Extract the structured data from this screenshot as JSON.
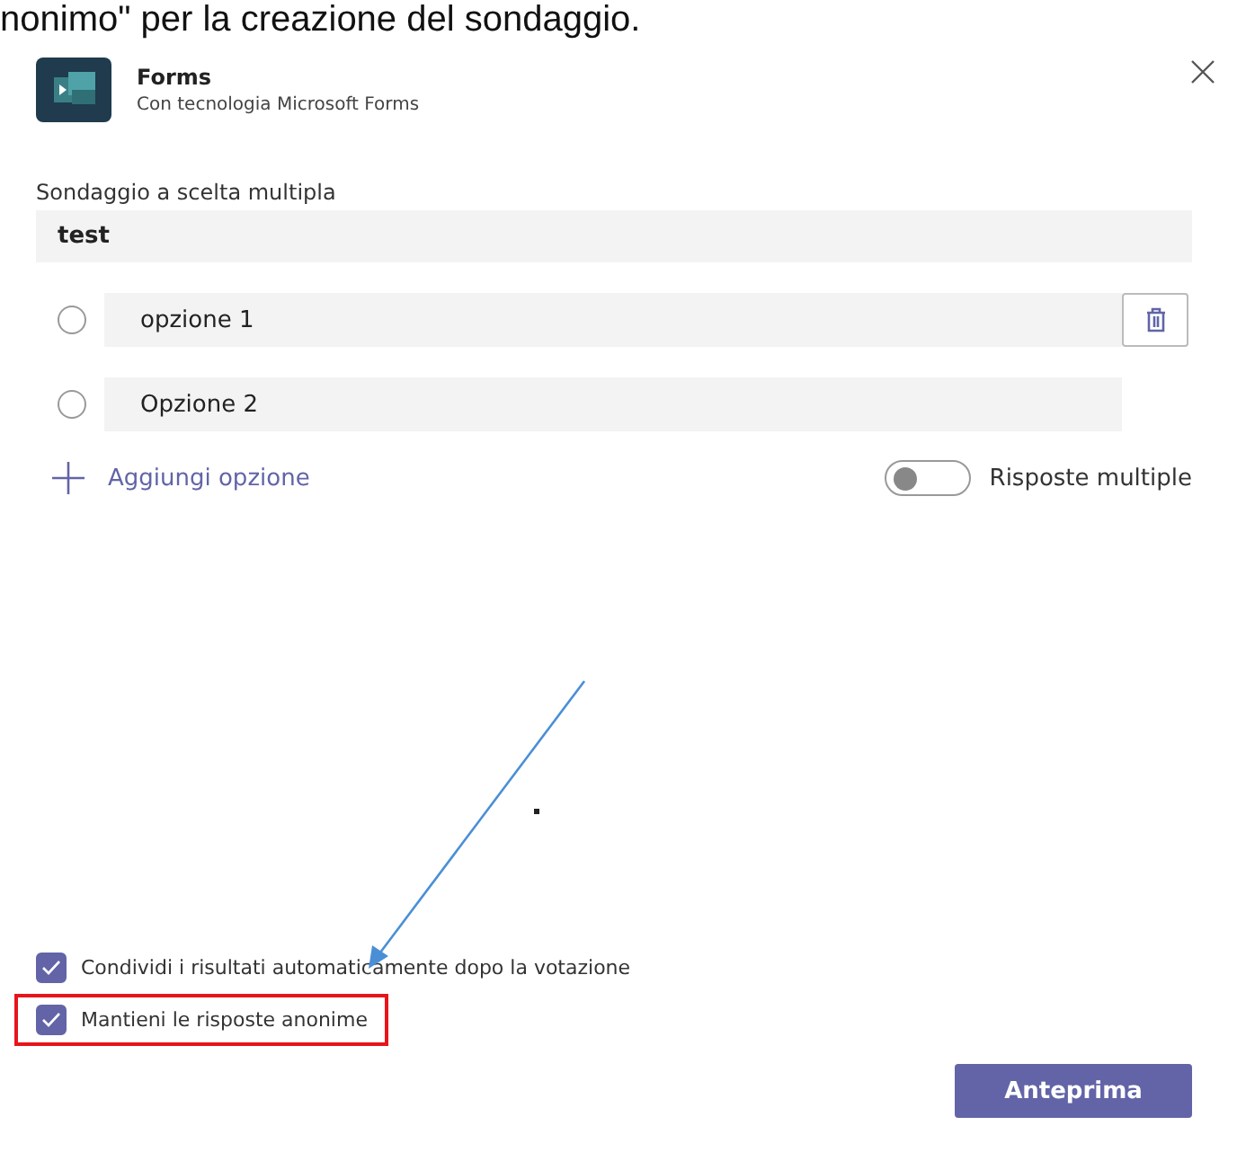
{
  "caption": "nonimo\" per la creazione del sondaggio.",
  "app": {
    "name": "Forms",
    "subtitle": "Con tecnologia Microsoft Forms"
  },
  "question": {
    "label": "Sondaggio a scelta multipla",
    "value": "test"
  },
  "options": [
    {
      "value": "opzione 1",
      "deletable": true,
      "selected": false
    },
    {
      "value": "Opzione 2",
      "deletable": false,
      "selected": false
    }
  ],
  "add_option": "Aggiungi opzione",
  "multiple_answers": {
    "label": "Risposte multiple",
    "on": false
  },
  "settings": [
    {
      "label": "Condividi i risultati automaticamente dopo la votazione",
      "checked": true,
      "highlighted": false
    },
    {
      "label": "Mantieni le risposte anonime",
      "checked": true,
      "highlighted": true
    }
  ],
  "preview_button": "Anteprima"
}
